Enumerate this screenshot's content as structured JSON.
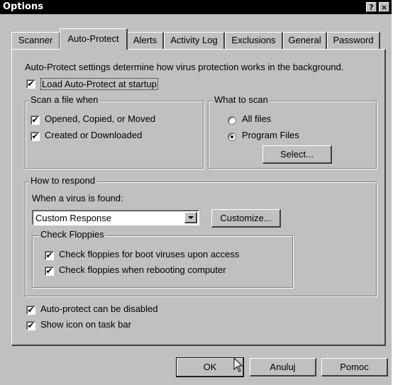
{
  "window": {
    "title": "Options",
    "help_btn": "?",
    "close_btn": "×"
  },
  "tabs": [
    "Scanner",
    "Auto-Protect",
    "Alerts",
    "Activity Log",
    "Exclusions",
    "General",
    "Password"
  ],
  "active_tab": "Auto-Protect",
  "intro": "Auto-Protect settings determine how virus protection works in the background.",
  "load_at_startup": {
    "label": "Load Auto-Protect at startup",
    "checked": true
  },
  "scan_when": {
    "title": "Scan a file when",
    "opened": {
      "label": "Opened, Copied, or Moved",
      "checked": true
    },
    "created": {
      "label": "Created or Downloaded",
      "checked": true
    }
  },
  "what_to_scan": {
    "title": "What to scan",
    "all_files": {
      "label": "All files",
      "selected": false
    },
    "program_files": {
      "label": "Program Files",
      "selected": true
    },
    "select_btn": "Select..."
  },
  "respond": {
    "title": "How to respond",
    "when_found": "When a virus is found:",
    "dropdown_value": "Custom Response",
    "customize_btn": "Customize...",
    "floppies": {
      "title": "Check Floppies",
      "boot": {
        "label": "Check floppies for boot viruses upon access",
        "checked": true
      },
      "reboot": {
        "label": "Check floppies when rebooting computer",
        "checked": true
      }
    }
  },
  "can_disable": {
    "label": "Auto-protect can be disabled",
    "checked": true
  },
  "show_icon": {
    "label": "Show icon on task bar",
    "checked": true
  },
  "buttons": {
    "ok": "OK",
    "cancel": "Anuluj",
    "help": "Pomoc"
  },
  "check_glyph": "✔"
}
